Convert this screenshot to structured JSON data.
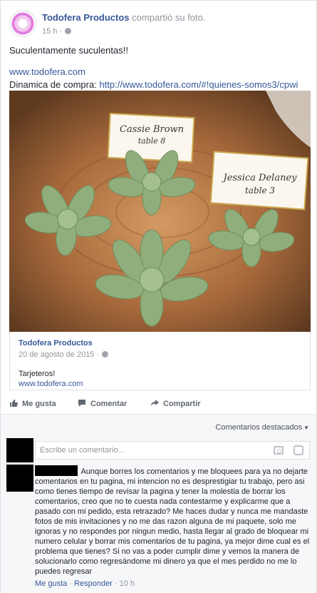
{
  "post": {
    "author": "Todofera Productos",
    "action": " compartió su foto.",
    "time": "15 h",
    "caption": "Suculentamente suculentas!!",
    "website": "www.todofera.com",
    "dinamica_label": "Dinamica de compra: ",
    "dinamica_link": "http://www.todofera.com/#!quienes-somos3/cpwi",
    "photo_cards": [
      "Cassie Brown",
      "table 8",
      "Jessica Delaney",
      "table 3"
    ]
  },
  "preview": {
    "name": "Todofera Productos",
    "date": "20 de agosto de 2015",
    "description": "Tarjeteros!",
    "link": "www.todofera.com"
  },
  "actions": {
    "like": "Me gusta",
    "comment": "Comentar",
    "share": "Compartir"
  },
  "comments": {
    "sort_label": "Comentarios destacados",
    "placeholder": "Escribe un comentario...",
    "first": {
      "text": "Aunque borres los comentarios y me bloquees para ya no dejarte comentarios en tu pagina, mi intencion no es desprestigiar tu trabajo, pero asi como tienes tiempo de revisar la pagina y tener la molestia de borrar los comentarios, creo que no te cuesta nada contestarme y explicarme que a pasado con mi pedido, esta retrazado? Me haces dudar y nunca me mandaste fotos de mis invitaciones y no me das razon alguna de mi paquete, solo me ignoras y no respondes por ningun medio, hasta llegar al grado de bloquear mi numero celular y borrar mis comentarios de tu pagina, ya mejor dime cual es el problema que tienes? Si no vas a poder cumplir dime y vemos la manera de solucionarlo como regresándome mi dinero ya que el mes perdido no me lo puedes regresar",
      "like": "Me gusta",
      "reply": "Responder",
      "time": "10 h"
    }
  },
  "colors": {
    "link": "#365899",
    "muted": "#90949c",
    "plant": "#8fae7c"
  }
}
